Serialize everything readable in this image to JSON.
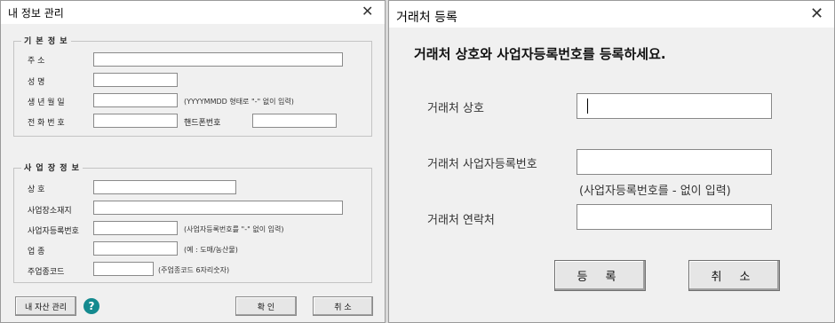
{
  "left": {
    "title": "내 정보 관리",
    "basic": {
      "group_title": "기 본 정 보",
      "address_label": "주        소",
      "name_label": "성        명",
      "birth_label": "생 년 월 일",
      "birth_hint": "(YYYYMMDD 형태로 \"-\" 없이 입력)",
      "phone_label": "전 화 번 호",
      "mobile_label": "핸드폰번호"
    },
    "business": {
      "group_title": "사 업 장 정 보",
      "company_label": "상        호",
      "location_label": "사업장소재지",
      "regno_label": "사업자등록번호",
      "regno_hint": "(사업자등록번호를 \"-\" 없이 입력)",
      "type_label": "업        종",
      "type_hint": "(예 : 도매/농산물)",
      "code_label": "주업종코드",
      "code_hint": "(주업종코드 6자리숫자)"
    },
    "assets_button": "내 자산 관리",
    "help_icon": "?",
    "ok_button": "확   인",
    "cancel_button": "취   소"
  },
  "right": {
    "title": "거래처 등록",
    "instruction": "거래처 상호와 사업자등록번호를 등록하세요.",
    "company_label": "거래처 상호",
    "regno_label": "거래처 사업자등록번호",
    "regno_hint": "(사업자등록번호를 - 없이 입력)",
    "contact_label": "거래처 연락처",
    "register_button": "등 록",
    "cancel_button": "취 소"
  },
  "colors": {
    "help_icon_bg": "#148a8f",
    "dialog_bg": "#f0f0f0"
  }
}
